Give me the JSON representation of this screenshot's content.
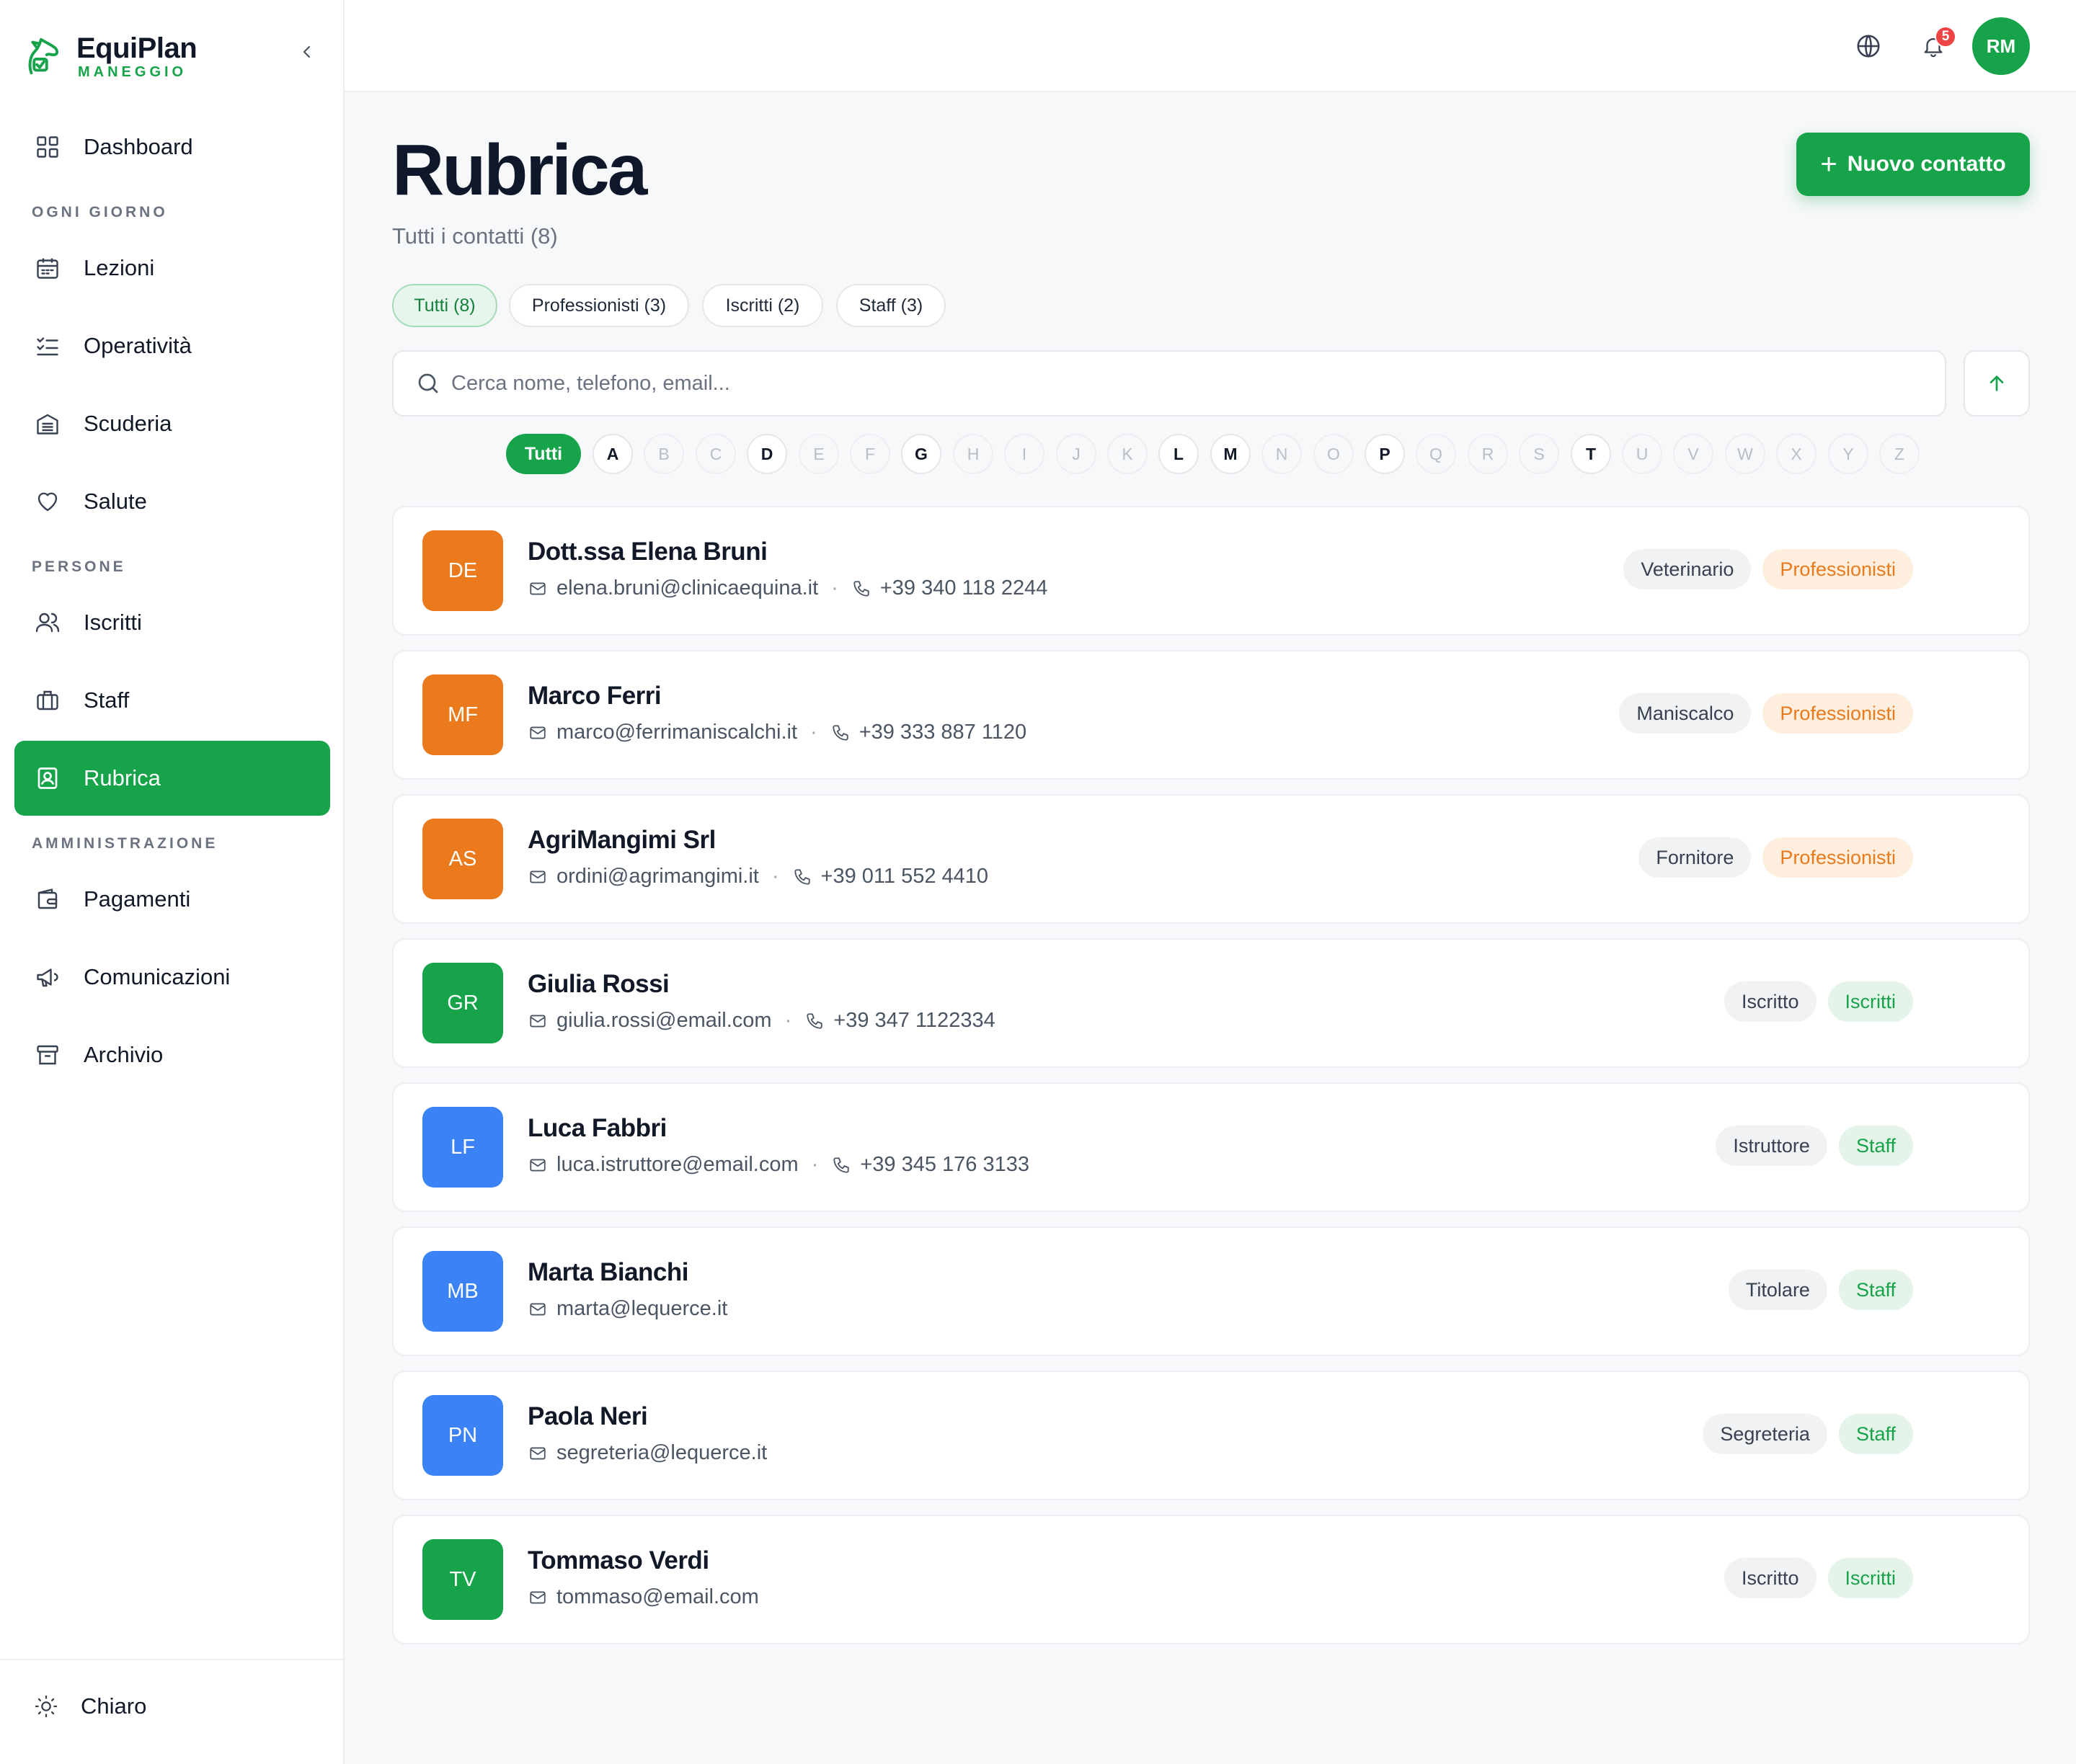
{
  "brand": {
    "name": "EquiPlan",
    "sub": "MANEGGIO"
  },
  "sidebar": {
    "dashboard": "Dashboard",
    "sections": {
      "daily": "OGNI GIORNO",
      "people": "PERSONE",
      "admin": "AMMINISTRAZIONE"
    },
    "items": {
      "lezioni": "Lezioni",
      "operativita": "Operatività",
      "scuderia": "Scuderia",
      "salute": "Salute",
      "iscritti": "Iscritti",
      "staff": "Staff",
      "rubrica": "Rubrica",
      "pagamenti": "Pagamenti",
      "comunicazioni": "Comunicazioni",
      "archivio": "Archivio"
    },
    "theme": "Chiaro"
  },
  "topbar": {
    "notif_count": "5",
    "user_initials": "RM"
  },
  "page": {
    "title": "Rubrica",
    "subtitle": "Tutti i contatti (8)",
    "new_button": "Nuovo contatto",
    "new_button_plus": "+"
  },
  "filters": {
    "all": "Tutti  (8)",
    "pro": "Professionisti  (3)",
    "isc": "Iscritti  (2)",
    "staff": "Staff  (3)"
  },
  "search": {
    "placeholder": "Cerca nome, telefono, email..."
  },
  "alphabet": {
    "all": "Tutti",
    "letters": [
      "A",
      "B",
      "C",
      "D",
      "E",
      "F",
      "G",
      "H",
      "I",
      "J",
      "K",
      "L",
      "M",
      "N",
      "O",
      "P",
      "Q",
      "R",
      "S",
      "T",
      "U",
      "V",
      "W",
      "X",
      "Y",
      "Z"
    ],
    "enabled": [
      "A",
      "D",
      "G",
      "L",
      "M",
      "P",
      "T"
    ]
  },
  "contacts": [
    {
      "initials": "DE",
      "name": "Dott.ssa Elena Bruni",
      "email": "elena.bruni@clinicaequina.it",
      "phone": "+39 340 118 2244",
      "role": "Veterinario",
      "category": "Professionisti",
      "color": "#ea7a1b"
    },
    {
      "initials": "MF",
      "name": "Marco Ferri",
      "email": "marco@ferrimaniscalchi.it",
      "phone": "+39 333 887 1120",
      "role": "Maniscalco",
      "category": "Professionisti",
      "color": "#ea7a1b"
    },
    {
      "initials": "AS",
      "name": "AgriMangimi Srl",
      "email": "ordini@agrimangimi.it",
      "phone": "+39 011 552 4410",
      "role": "Fornitore",
      "category": "Professionisti",
      "color": "#ea7a1b"
    },
    {
      "initials": "GR",
      "name": "Giulia Rossi",
      "email": "giulia.rossi@email.com",
      "phone": "+39 347 1122334",
      "role": "Iscritto",
      "category": "Iscritti",
      "color": "#16a34a"
    },
    {
      "initials": "LF",
      "name": "Luca Fabbri",
      "email": "luca.istruttore@email.com",
      "phone": "+39 345 176 3133",
      "role": "Istruttore",
      "category": "Staff",
      "color": "#3b82f6"
    },
    {
      "initials": "MB",
      "name": "Marta Bianchi",
      "email": "marta@lequerce.it",
      "phone": "",
      "role": "Titolare",
      "category": "Staff",
      "color": "#3b82f6"
    },
    {
      "initials": "PN",
      "name": "Paola Neri",
      "email": "segreteria@lequerce.it",
      "phone": "",
      "role": "Segreteria",
      "category": "Staff",
      "color": "#3b82f6"
    },
    {
      "initials": "TV",
      "name": "Tommaso Verdi",
      "email": "tommaso@email.com",
      "phone": "",
      "role": "Iscritto",
      "category": "Iscritti",
      "color": "#16a34a"
    }
  ],
  "colors": {
    "accent": "#16a34a",
    "orange": "#ea7a1b",
    "blue": "#3b82f6",
    "badge": "#ef4444"
  }
}
